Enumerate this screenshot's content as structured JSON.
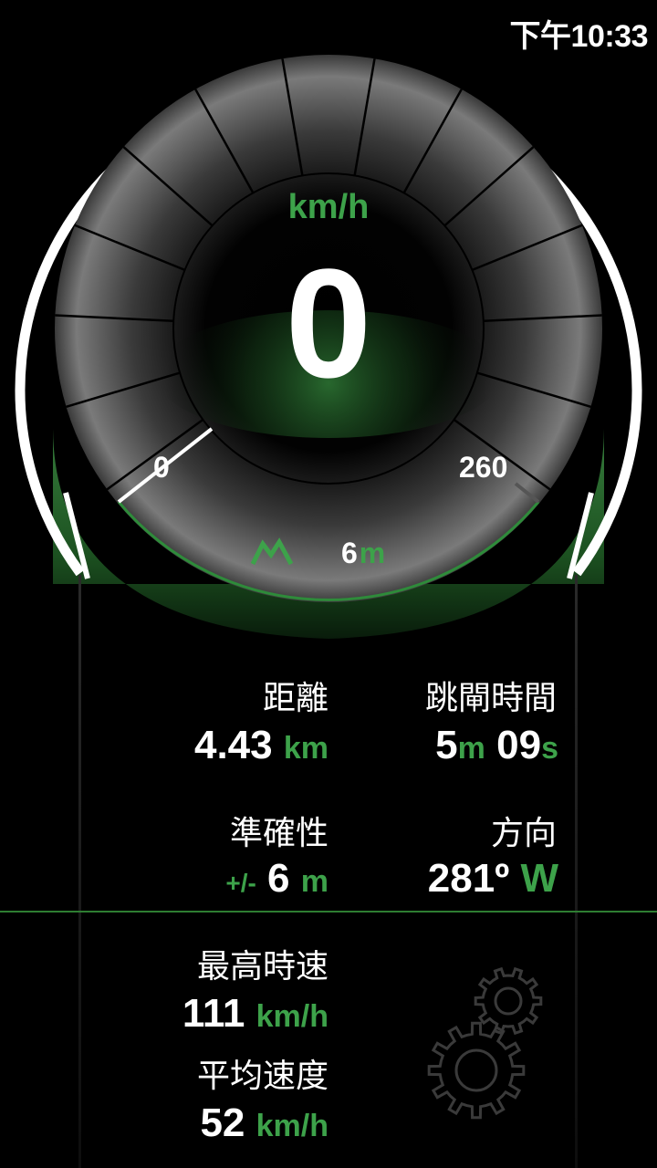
{
  "status_bar": {
    "time": "下午10:33"
  },
  "speedometer": {
    "speed": "0",
    "unit": "km/h",
    "scale_min": "0",
    "scale_max": "260",
    "altitude_value": "6",
    "altitude_unit": "m"
  },
  "stats": {
    "distance": {
      "label": "距離",
      "value": "4.43",
      "unit": "km"
    },
    "jump_time": {
      "label": "跳閘時間",
      "min_value": "5",
      "min_unit": "m",
      "sec_value": "09",
      "sec_unit": "s"
    },
    "accuracy": {
      "label": "準確性",
      "prefix": "+/-",
      "value": "6",
      "unit": "m"
    },
    "direction": {
      "label": "方向",
      "value": "281º",
      "cardinal": "W"
    },
    "max_speed": {
      "label": "最高時速",
      "value": "111",
      "unit": "km/h"
    },
    "avg_speed": {
      "label": "平均速度",
      "value": "52",
      "unit": "km/h"
    }
  },
  "colors": {
    "accent": "#3da24a",
    "background": "#000000",
    "text": "#ffffff"
  },
  "icons": {
    "altitude": "mountain-icon",
    "settings": "gears-icon"
  }
}
